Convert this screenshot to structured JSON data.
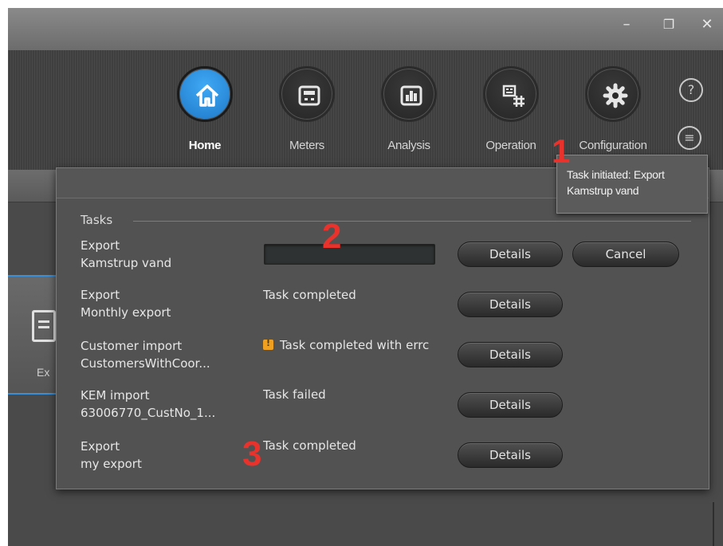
{
  "window_controls": {
    "minimize": "–",
    "restore": "❐",
    "close": "✕"
  },
  "nav": {
    "items": [
      {
        "label": "Home",
        "icon": "home-icon"
      },
      {
        "label": "Meters",
        "icon": "meter-icon"
      },
      {
        "label": "Analysis",
        "icon": "bar-chart-icon"
      },
      {
        "label": "Operation",
        "icon": "operation-icon"
      },
      {
        "label": "Configuration",
        "icon": "gear-icon"
      }
    ],
    "help": "?",
    "tasks_icon": "≡",
    "accent": "#2a8fe0"
  },
  "background": {
    "card_label": "Ex"
  },
  "tasks": {
    "legend": "Tasks",
    "rows": [
      {
        "type": "Export",
        "name": "Kamstrup vand",
        "status": "",
        "progress": 0,
        "details": "Details",
        "cancel": "Cancel"
      },
      {
        "type": "Export",
        "name": "Monthly export",
        "status": "Task completed",
        "details": "Details"
      },
      {
        "type": "Customer import",
        "name": "CustomersWithCoor...",
        "status": "Task completed with errc",
        "warning": true,
        "details": "Details"
      },
      {
        "type": "KEM import",
        "name": "63006770_CustNo_1...",
        "status": "Task failed",
        "details": "Details"
      },
      {
        "type": "Export",
        "name": "my export",
        "status": "Task completed",
        "details": "Details"
      }
    ]
  },
  "tooltip": {
    "line1": "Task initiated: Export",
    "line2": "Kamstrup vand"
  },
  "annotations": {
    "one": "1",
    "two": "2",
    "three": "3",
    "color": "#e8322b"
  }
}
